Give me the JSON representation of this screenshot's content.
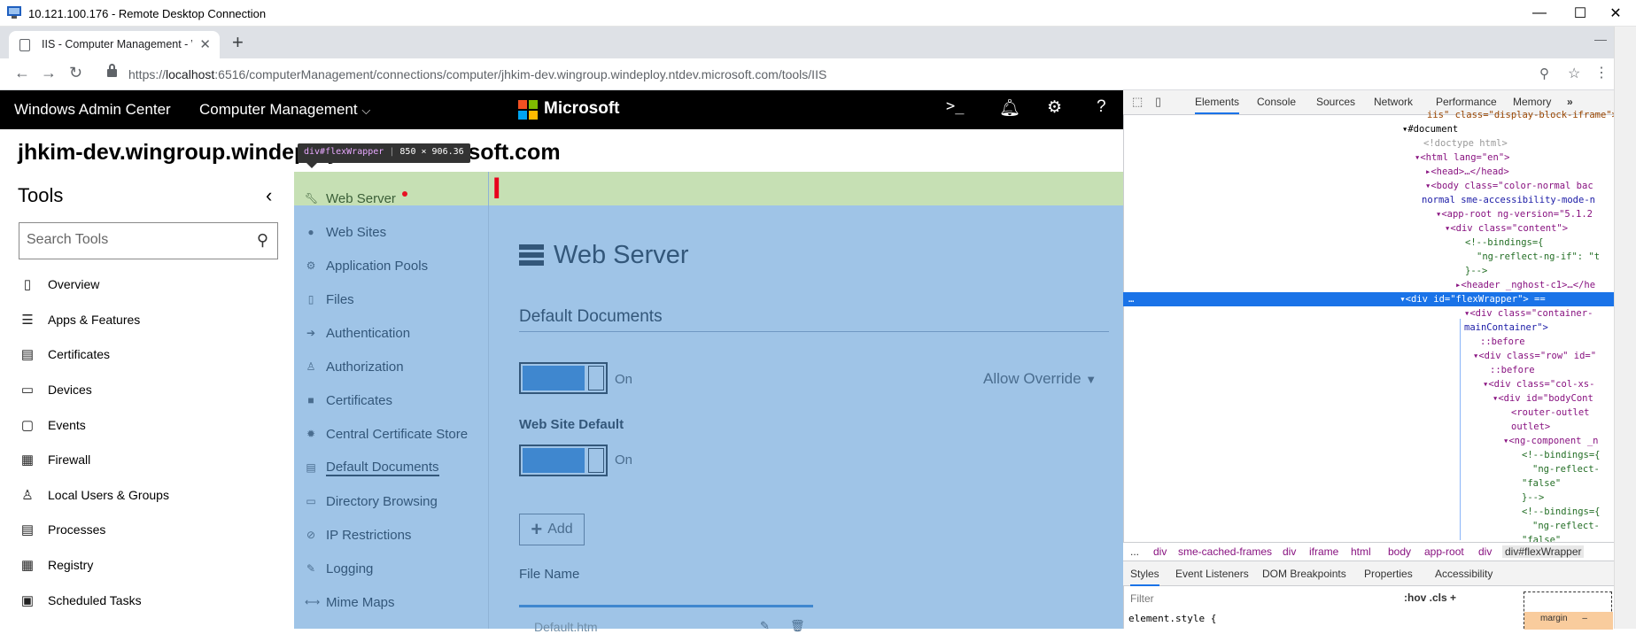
{
  "rdp": {
    "title": "10.121.100.176 - Remote Desktop Connection"
  },
  "browser": {
    "tab_title": "IIS - Computer Management - W",
    "url_prefix": "https://",
    "url_host": "localhost",
    "url_rest": ":6516/computerManagement/connections/computer/jhkim-dev.wingroup.windeploy.ntdev.microsoft.com/tools/IIS"
  },
  "wac": {
    "brand": "Windows Admin Center",
    "context": "Computer Management",
    "logo_text": "Microsoft",
    "machine_name": "jhkim-dev.wingroup.windeploy.ntdev.microsoft.com"
  },
  "tooltip": {
    "tag": "div#flexWrapper",
    "size": "850 × 906.36"
  },
  "tools": {
    "title": "Tools",
    "search_placeholder": "Search Tools",
    "items": [
      {
        "label": "Overview",
        "icon": "overview-icon"
      },
      {
        "label": "Apps & Features",
        "icon": "list-icon"
      },
      {
        "label": "Certificates",
        "icon": "certificate-icon"
      },
      {
        "label": "Devices",
        "icon": "devices-icon"
      },
      {
        "label": "Events",
        "icon": "events-icon"
      },
      {
        "label": "Firewall",
        "icon": "firewall-icon"
      },
      {
        "label": "Local Users & Groups",
        "icon": "users-icon"
      },
      {
        "label": "Processes",
        "icon": "processes-icon"
      },
      {
        "label": "Registry",
        "icon": "registry-icon"
      },
      {
        "label": "Scheduled Tasks",
        "icon": "tasks-icon"
      }
    ]
  },
  "iis_nav": {
    "items": [
      {
        "label": "Web Server"
      },
      {
        "label": "Web Sites"
      },
      {
        "label": "Application Pools"
      },
      {
        "label": "Files"
      },
      {
        "label": "Authentication"
      },
      {
        "label": "Authorization"
      },
      {
        "label": "Certificates"
      },
      {
        "label": "Central Certificate Store"
      },
      {
        "label": "Default Documents"
      },
      {
        "label": "Directory Browsing"
      },
      {
        "label": "IP Restrictions"
      },
      {
        "label": "Logging"
      },
      {
        "label": "Mime Maps"
      }
    ]
  },
  "content": {
    "title": "Web Server",
    "section": "Default Documents",
    "toggle1_label": "On",
    "allow_override": "Allow Override",
    "web_site_default": "Web Site Default",
    "toggle2_label": "On",
    "add_label": "Add",
    "file_name_header": "File Name",
    "first_row": "Default.htm"
  },
  "devtools": {
    "tabs": [
      "Elements",
      "Console",
      "Sources",
      "Network",
      "Performance",
      "Memory"
    ],
    "tree": [
      {
        "text": "iis\" class=\"display-block-iframe\">"
      },
      {
        "text": "▾#document"
      },
      {
        "text": "<!doctype html>"
      },
      {
        "text": "▾<html lang=\"en\">"
      },
      {
        "text": "▸<head>…</head>"
      },
      {
        "text": "▾<body class=\"color-normal bac"
      },
      {
        "text": "normal sme-accessibility-mode-n"
      },
      {
        "text": "▾<app-root ng-version=\"5.1.2"
      },
      {
        "text": "▾<div class=\"content\">"
      },
      {
        "text": "<!--bindings={"
      },
      {
        "text": "\"ng-reflect-ng-if\": \"t"
      },
      {
        "text": "}-->"
      },
      {
        "text": "▸<header _nghost-c1>…</he"
      },
      {
        "text": "▾<div id=\"flexWrapper\"> =="
      },
      {
        "text": "▾<div class=\"container-"
      },
      {
        "text": "mainContainer\">"
      },
      {
        "text": "::before"
      },
      {
        "text": "▾<div class=\"row\" id=\""
      },
      {
        "text": "::before"
      },
      {
        "text": "▾<div class=\"col-xs-"
      },
      {
        "text": "▾<div id=\"bodyCont"
      },
      {
        "text": "<router-outlet"
      },
      {
        "text": "outlet>"
      },
      {
        "text": "▾<ng-component _n"
      },
      {
        "text": "<!--bindings={"
      },
      {
        "text": "\"ng-reflect-"
      },
      {
        "text": "\"false\""
      },
      {
        "text": "}-->"
      },
      {
        "text": "<!--bindings={"
      },
      {
        "text": "\"ng-reflect-"
      },
      {
        "text": "\"false\""
      }
    ],
    "breadcrumbs": [
      "...",
      "div",
      "sme-cached-frames",
      "div",
      "iframe",
      "html",
      "body",
      "app-root",
      "div",
      "div#flexWrapper"
    ],
    "styles_tabs": [
      "Styles",
      "Event Listeners",
      "DOM Breakpoints",
      "Properties",
      "Accessibility"
    ],
    "filter_placeholder": "Filter",
    "filter_right": ":hov  .cls  +",
    "element_style": "element.style {",
    "box_model_label": "margin",
    "box_model_value": "–"
  },
  "colors": {
    "highlight_green": "#c6e0b4",
    "highlight_blue": "#9fc4e7",
    "accent": "#1a73e8"
  }
}
